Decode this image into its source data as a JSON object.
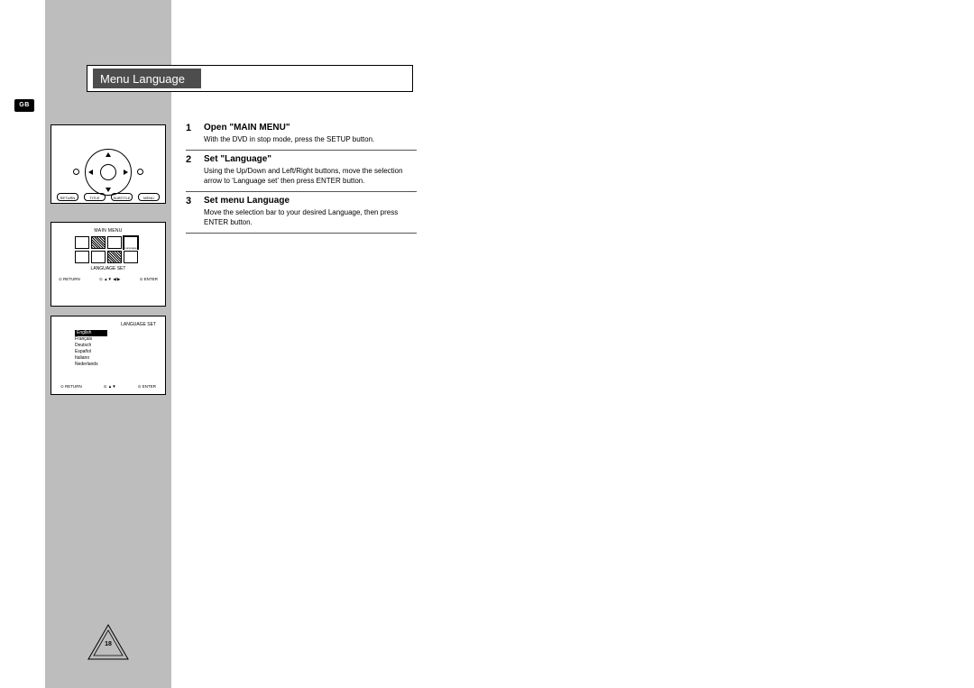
{
  "region_tab": "GB",
  "title": "Menu Language",
  "remote": {
    "buttons": [
      "RETURN",
      "TITLE",
      "SUBTITLE",
      "MENU"
    ]
  },
  "main_menu": {
    "heading": "MAIN MENU",
    "selected_label": "Language",
    "subtitle": "LANGUAGE SET",
    "footer": {
      "left": "RETURN",
      "mid": "▲▼   ◀/▶",
      "right": "ENTER"
    }
  },
  "language_set": {
    "heading": "LANGUAGE SET",
    "items": [
      "English",
      "Français",
      "Deutsch",
      "Español",
      "Italiano",
      "Nederlands"
    ],
    "selected_index": 0,
    "footer": {
      "left": "RETURN",
      "mid": "▲▼",
      "right": "ENTER"
    }
  },
  "steps": [
    {
      "num": "1",
      "title": "Open \"MAIN MENU\"",
      "text": "With the DVD in stop mode, press the SETUP button."
    },
    {
      "num": "2",
      "title": "Set \"Language\"",
      "text": "Using the Up/Down and Left/Right buttons, move the selection arrow to ‘Language set’ then press ENTER button."
    },
    {
      "num": "3",
      "title": "Set menu Language",
      "text": "Move the selection bar to your desired Language, then press ENTER button."
    }
  ],
  "page_number": "18"
}
